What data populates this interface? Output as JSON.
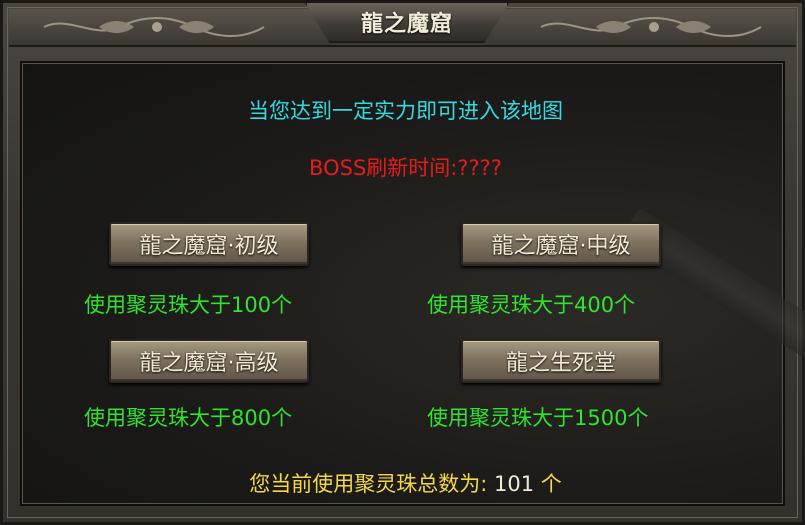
{
  "window": {
    "title": "龍之魔窟"
  },
  "intro_text": "当您达到一定实力即可进入该地图",
  "boss_text": "BOSS刷新时间:????",
  "maps": [
    {
      "label": "龍之魔窟·初级",
      "requirement": "使用聚灵珠大于100个"
    },
    {
      "label": "龍之魔窟·中级",
      "requirement": "使用聚灵珠大于400个"
    },
    {
      "label": "龍之魔窟·高级",
      "requirement": "使用聚灵珠大于800个"
    },
    {
      "label": "龍之生死堂",
      "requirement": "使用聚灵珠大于1500个"
    }
  ],
  "footer": {
    "prefix": "您当前使用聚灵珠总数为:",
    "count": "101",
    "unit": "个"
  },
  "colors": {
    "intro": "#37d8e0",
    "boss": "#e61c1c",
    "requirement": "#2fe32f",
    "footer": "#f4d84a"
  },
  "icons": {
    "title_ornament_left": "dragon-ornament-icon",
    "title_ornament_right": "dragon-ornament-icon",
    "background": "sword-icon"
  }
}
